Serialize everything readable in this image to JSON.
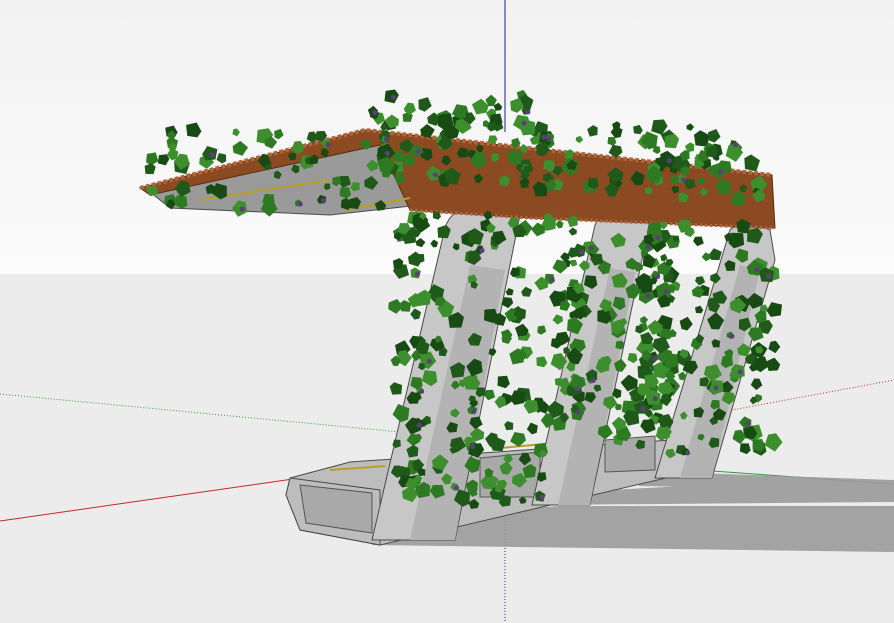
{
  "viewport": {
    "sky_top_color": "#f2f2f2",
    "sky_bottom_color": "#fbfbfb",
    "ground_color": "#ececec",
    "model": {
      "roof_color": "#8b4a22",
      "roof_edge_color": "#b0643a",
      "roof_underside_color": "#9a9a9a",
      "arch_color": "#c7c7c7",
      "arch_edge_color": "#4a4a4a",
      "bench_color": "#bdbdbd",
      "bench_panel_color": "#a9a9a9",
      "bench_stripe_color": "#b8a028",
      "shadow_color": "#9b9b9b",
      "foliage_colors": [
        "#1f5a1a",
        "#2e7a23",
        "#3d8f2d",
        "#184a14"
      ],
      "flower_color": "#5b3f7a"
    },
    "axes": {
      "x_color": "#c62828",
      "y_color": "#2e9a2e",
      "z_color": "#1a237e"
    }
  }
}
